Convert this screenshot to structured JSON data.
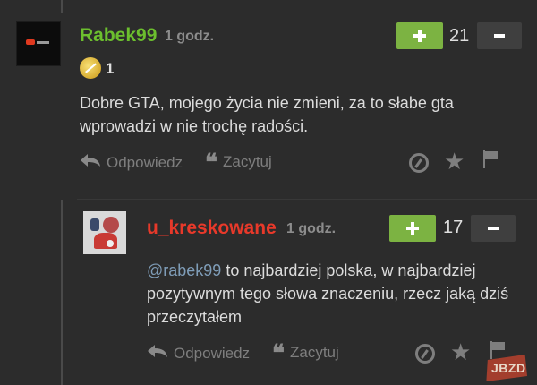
{
  "comments": [
    {
      "author": "Rabek99",
      "time": "1 godz.",
      "vote_count": "21",
      "badge_count": "1",
      "body": "Dobre GTA, mojego życia nie zmieni, za to słabe gta wprowadzi w nie trochę radości.",
      "reply_label": "Odpowiedz",
      "quote_label": "Zacytuj",
      "author_color": "#6cbf2e"
    },
    {
      "author": "u_kreskowane",
      "time": "1 godz.",
      "vote_count": "17",
      "mention": "@rabek99",
      "body": " to najbardziej polska, w najbardziej pozytywnym tego słowa znaczeniu, rzecz jaką dziś przeczytałem",
      "reply_label": "Odpowiedz",
      "quote_label": "Zacytuj",
      "author_color": "#e8392a"
    }
  ],
  "watermark": "JBZD",
  "colors": {
    "plus_button": "#7cb342",
    "minus_button": "#3f3f3f",
    "background": "#2c2c2c"
  },
  "icons": [
    "reply-arrow-icon",
    "quote-icon",
    "no-game-icon",
    "star-icon",
    "flag-icon",
    "badge-icon"
  ]
}
